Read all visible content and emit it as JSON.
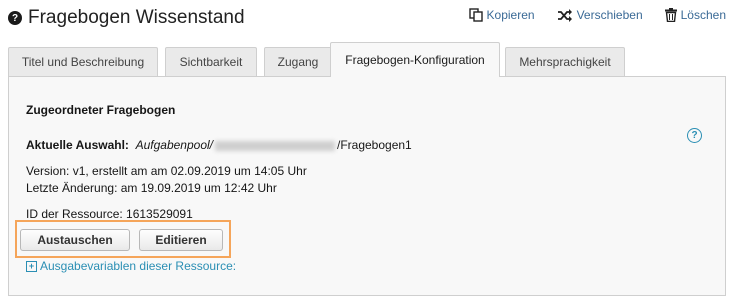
{
  "header": {
    "title": "Fragebogen Wissenstand",
    "actions": [
      {
        "label": "Kopieren",
        "icon": "copy-icon"
      },
      {
        "label": "Verschieben",
        "icon": "shuffle-icon"
      },
      {
        "label": "Löschen",
        "icon": "trash-icon"
      }
    ]
  },
  "tabs": [
    {
      "label": "Titel und Beschreibung",
      "active": false
    },
    {
      "label": "Sichtbarkeit",
      "active": false
    },
    {
      "label": "Zugang",
      "active": false
    },
    {
      "label": "Fragebogen-Konfiguration",
      "active": true
    },
    {
      "label": "Mehrsprachigkeit",
      "active": false
    }
  ],
  "panel": {
    "section_title": "Zugeordneter Fragebogen",
    "selection_label": "Aktuelle Auswahl:",
    "selection_pool": "Aufgabenpool/",
    "selection_name": "/Fragebogen1",
    "version": "Version:  v1, erstellt am am 02.09.2019 um 14:05 Uhr",
    "last_change": "Letzte Änderung: am 19.09.2019 um 12:42 Uhr",
    "resource_id": "ID der Ressource:  1613529091",
    "buttons": {
      "replace": "Austauschen",
      "edit": "Editieren"
    },
    "output_vars": "Ausgabevariablen dieser Ressource:"
  },
  "colors": {
    "link": "#3a6a96",
    "help": "#2b8fb4",
    "highlight": "#f5a55a"
  }
}
